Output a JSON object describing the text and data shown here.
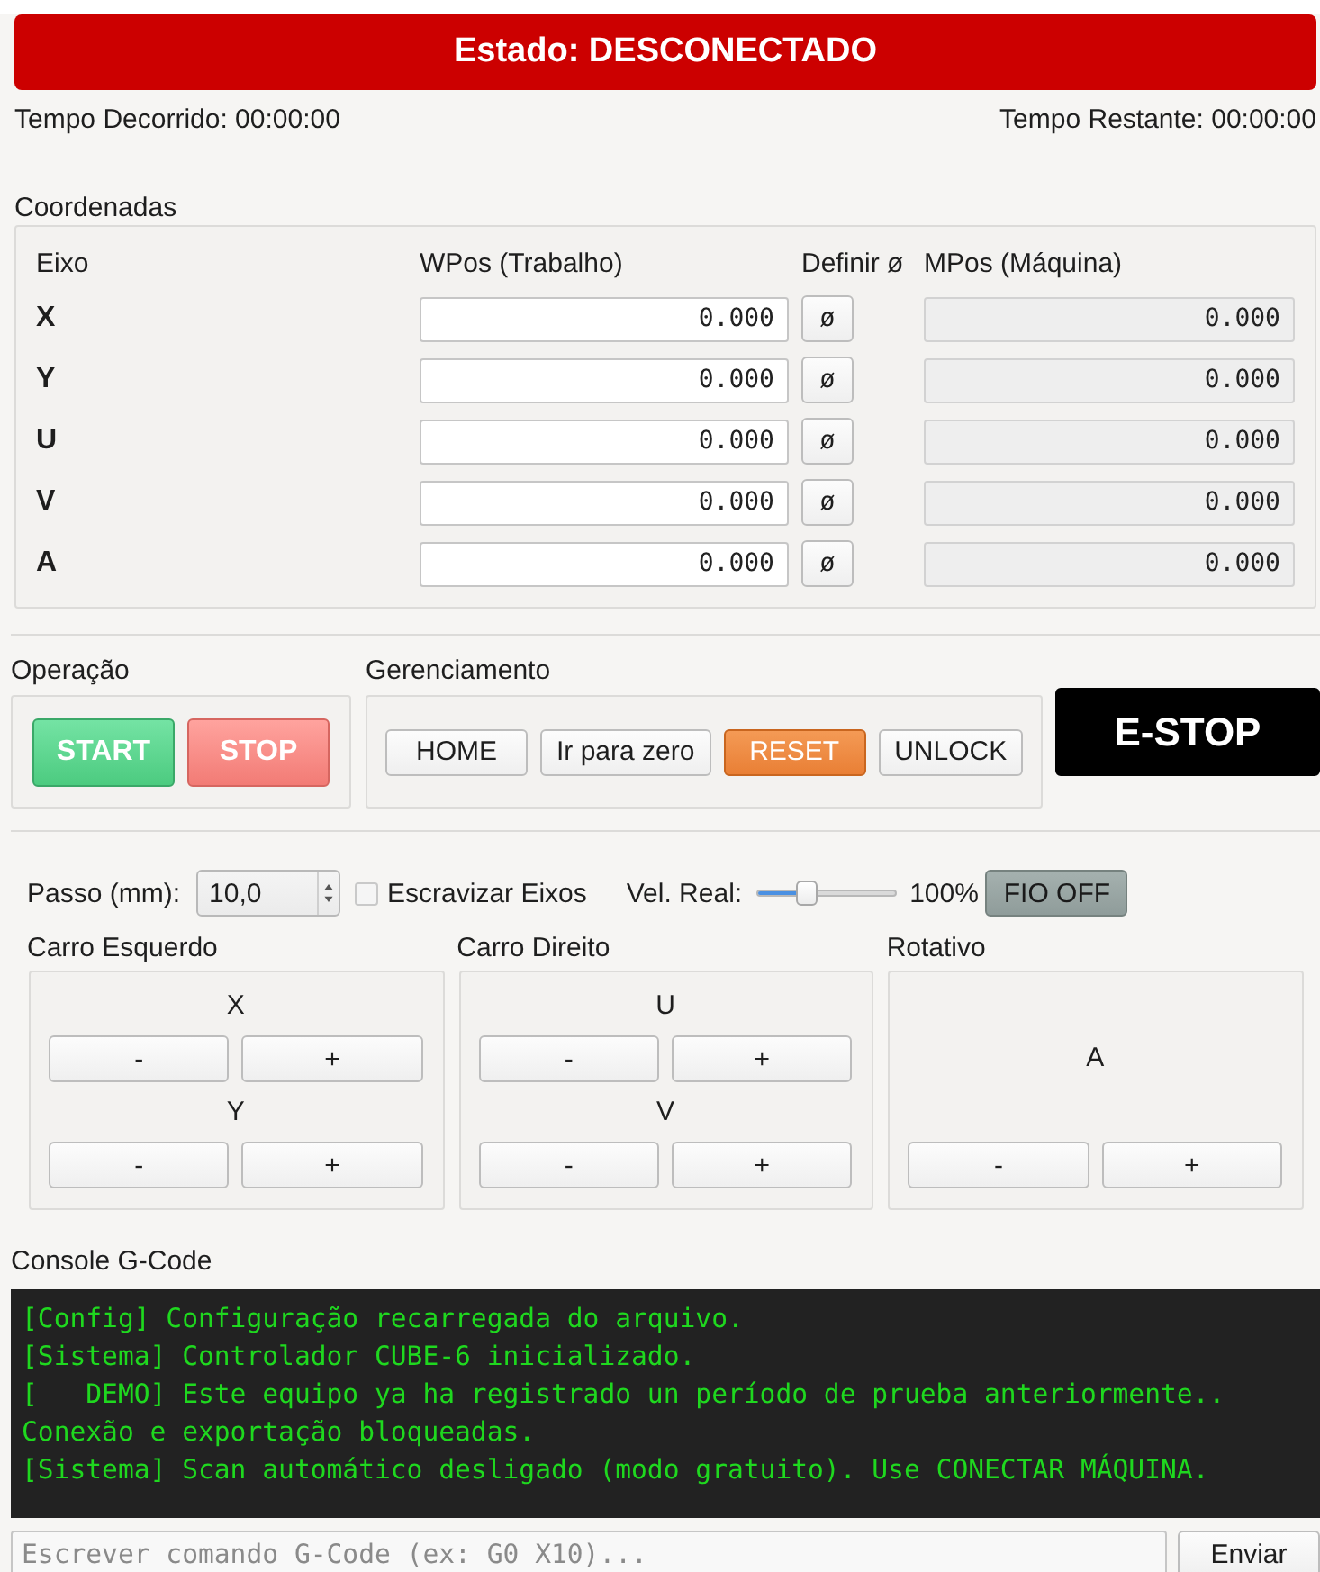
{
  "status": {
    "label": "Estado: DESCONECTADO",
    "connected": false
  },
  "timers": {
    "elapsed": "Tempo Decorrido: 00:00:00",
    "remaining": "Tempo Restante: 00:00:00"
  },
  "coordinates": {
    "title": "Coordenadas",
    "columns": [
      "Eixo",
      "WPos (Trabalho)",
      "Definir ø",
      "MPos (Máquina)"
    ],
    "rows": [
      {
        "axis": "X",
        "wpos": "0.000",
        "zero_button": "ø",
        "mpos": "0.000"
      },
      {
        "axis": "Y",
        "wpos": "0.000",
        "zero_button": "ø",
        "mpos": "0.000"
      },
      {
        "axis": "U",
        "wpos": "0.000",
        "zero_button": "ø",
        "mpos": "0.000"
      },
      {
        "axis": "V",
        "wpos": "0.000",
        "zero_button": "ø",
        "mpos": "0.000"
      },
      {
        "axis": "A",
        "wpos": "0.000",
        "zero_button": "ø",
        "mpos": "0.000"
      }
    ]
  },
  "operation": {
    "title": "Operação",
    "buttons": [
      {
        "label": "START",
        "kind": "start"
      },
      {
        "label": "STOP",
        "kind": "stop"
      }
    ]
  },
  "management": {
    "title": "Gerenciamento",
    "buttons": [
      {
        "label": "HOME",
        "kind": "default"
      },
      {
        "label": "Ir para zero",
        "kind": "default"
      },
      {
        "label": "RESET",
        "kind": "warning"
      },
      {
        "label": "UNLOCK",
        "kind": "default"
      }
    ]
  },
  "estop": {
    "label": "E-STOP"
  },
  "jog_settings": {
    "step_label": "Passo (mm):",
    "step_value": "10,0",
    "slave_axes": {
      "label": "Escravizar Eixos",
      "checked": false
    },
    "speed_label": "Vel. Real:",
    "speed": {
      "level": 0.33
    },
    "speed_reading": "100%",
    "wire_button": {
      "label": "FIO OFF",
      "on": false
    }
  },
  "jog_groups": [
    {
      "title": "Carro Esquerdo",
      "axes": [
        {
          "axis": "X",
          "minus": "-",
          "plus": "+"
        },
        {
          "axis": "Y",
          "minus": "-",
          "plus": "+"
        }
      ]
    },
    {
      "title": "Carro Direito",
      "axes": [
        {
          "axis": "U",
          "minus": "-",
          "plus": "+"
        },
        {
          "axis": "V",
          "minus": "-",
          "plus": "+"
        }
      ]
    },
    {
      "title": "Rotativo",
      "axes": [
        {
          "axis": "A",
          "minus": "-",
          "plus": "+"
        }
      ]
    }
  ],
  "console": {
    "title": "Console G-Code",
    "lines": [
      "[Config] Configuração recarregada do arquivo.",
      "[Sistema] Controlador CUBE-6 inicializado.",
      "[   DEMO] Este equipo ya ha registrado un período de prueba anteriormente..",
      "Conexão e exportação bloqueadas.",
      "[Sistema] Scan automático desligado (modo gratuito). Use CONECTAR MÁQUINA."
    ],
    "command_field": {
      "placeholder": "Escrever comando G-Code (ex: G0 X10)..."
    },
    "send_button": "Enviar"
  }
}
